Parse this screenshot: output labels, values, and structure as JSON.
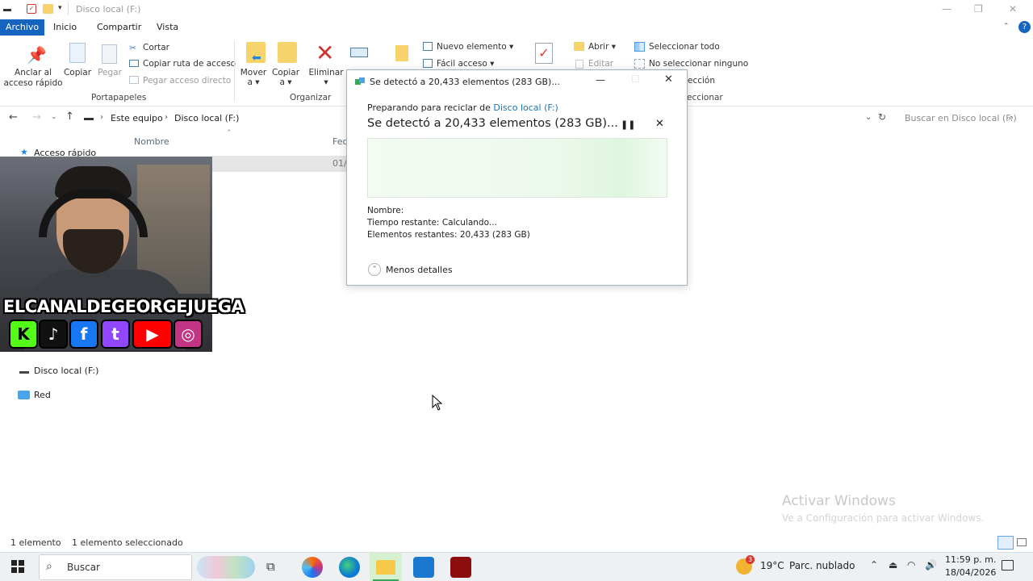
{
  "window": {
    "title": "Disco local (F:)"
  },
  "ribbon_tabs": [
    "Archivo",
    "Inicio",
    "Compartir",
    "Vista"
  ],
  "ribbon": {
    "pin_label": "Anclar al\nacceso rápido",
    "pin_line1": "Anclar al",
    "pin_line2": "acceso rápido",
    "copy_label": "Copiar",
    "paste_label": "Pegar",
    "cut_label": "Cortar",
    "copy_path_label": "Copiar ruta de acceso",
    "paste_shortcut_label": "Pegar acceso directo",
    "clipboard_group": "Portapapeles",
    "move_label": "Mover",
    "move_sub": "a ▾",
    "copyto_label": "Copiar",
    "copyto_sub": "a ▾",
    "delete_label": "Eliminar",
    "organize_group": "Organizar",
    "new_item_label": "Nuevo elemento ▾",
    "easy_access_label": "Fácil acceso ▾",
    "open_label": "Abrir ▾",
    "edit_label": "Editar",
    "select_all_label": "Seleccionar todo",
    "select_none_label": "No seleccionar ninguno",
    "invert_selection_partial": "ección",
    "select_group_partial": "eccionar"
  },
  "address": {
    "crumb1": "Este equipo",
    "sep": "›",
    "crumb2": "Disco local (F:)",
    "search_placeholder": "Buscar en Disco local (F:)"
  },
  "columns": {
    "name": "Nombre",
    "date_partial": "Fec",
    "row_date_partial": "01/"
  },
  "nav": {
    "quick_access": "Acceso rápido",
    "this_pc_partial": "Este equipo",
    "local_disk": "Disco local (F:)",
    "network": "Red"
  },
  "overlay": {
    "channel_name": "ELCANALDEGEORGEJUEGA",
    "socials": [
      "kick-icon",
      "tiktok-icon",
      "facebook-icon",
      "twitch-icon",
      "youtube-icon",
      "instagram-icon"
    ],
    "social_glyphs": [
      "K",
      "♪",
      "f",
      "t",
      "▶",
      "◎"
    ],
    "social_colors": [
      "#53fc18",
      "#111111",
      "#1877f2",
      "#9146ff",
      "#ff0000",
      "#c13584"
    ]
  },
  "dialog": {
    "title": "Se detectó a 20,433 elementos (283 GB)...",
    "preparing_prefix": "Preparando para reciclar de",
    "preparing_link": "Disco local (F:)",
    "headline": "Se detectó a 20,433 elementos (283 GB)...",
    "name_label": "Nombre:",
    "time_label": "Tiempo restante:",
    "time_value": "Calculando...",
    "items_label": "Elementos restantes:",
    "items_value": "20,433 (283 GB)",
    "less_details": "Menos detalles"
  },
  "watermark": {
    "line1": "Activar Windows",
    "line2": "Ve a Configuración para activar Windows."
  },
  "status": {
    "count": "1 elemento",
    "selected": "1 elemento seleccionado"
  },
  "taskbar": {
    "search_placeholder": "Buscar",
    "weather_temp": "19°C",
    "weather_desc": "Parc. nublado",
    "weather_badge": "3",
    "time": "11:59 p. m.",
    "date": "18/04/2026"
  },
  "colors": {
    "accent": "#1565c0",
    "delete_red": "#d32f2f",
    "link": "#1a73b8"
  }
}
